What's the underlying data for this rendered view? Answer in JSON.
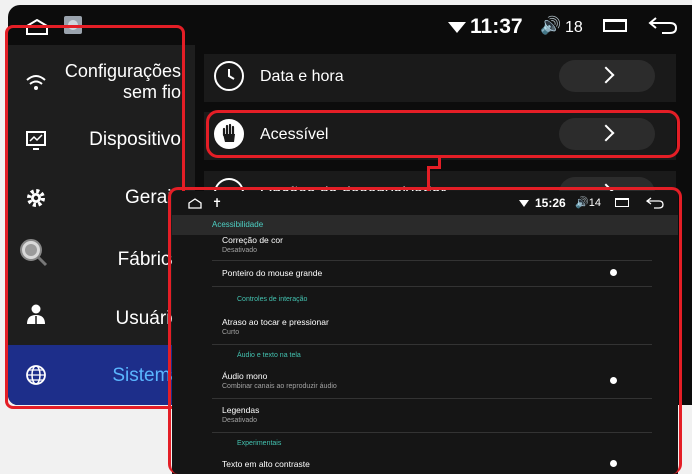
{
  "main": {
    "status": {
      "time": "11:37",
      "volume_icon": "🔊",
      "volume": "18"
    },
    "sidebar": {
      "items": [
        {
          "label": "Configurações sem fio",
          "icon": "wifi-icon"
        },
        {
          "label": "Dispositivo",
          "icon": "monitor-icon"
        },
        {
          "label": "Gerais",
          "icon": "gear-icon"
        },
        {
          "label": "Fábrica",
          "icon": "magnifier-icon"
        },
        {
          "label": "Usuário",
          "icon": "user-icon"
        },
        {
          "label": "Sistema",
          "icon": "globe-icon"
        }
      ]
    },
    "rows": [
      {
        "label": "Data e hora",
        "icon": "clock-icon"
      },
      {
        "label": "Acessível",
        "icon": "hand-icon"
      },
      {
        "label": "Opções do desenvolvedor",
        "icon": "gear-icon"
      }
    ]
  },
  "overlay": {
    "status": {
      "time": "15:26",
      "volume": "14"
    },
    "header": "Acessibilidade",
    "items": [
      {
        "title": "Correção de cor",
        "sub": "Desativado"
      },
      {
        "title": "Ponteiro do mouse grande"
      },
      {
        "section": "Controles de interação"
      },
      {
        "title": "Atraso ao tocar e pressionar",
        "sub": "Curto"
      },
      {
        "section": "Áudio e texto na tela"
      },
      {
        "title": "Áudio mono",
        "sub": "Combinar canais ao reproduzir áudio"
      },
      {
        "title": "Legendas",
        "sub": "Desativado"
      },
      {
        "section": "Experimentais"
      },
      {
        "title": "Texto em alto contraste"
      }
    ]
  },
  "colors": {
    "highlight": "#e41e26",
    "active_bg": "#1d2e8a",
    "active_text": "#5ab6ff",
    "teal": "#43c2b0"
  }
}
